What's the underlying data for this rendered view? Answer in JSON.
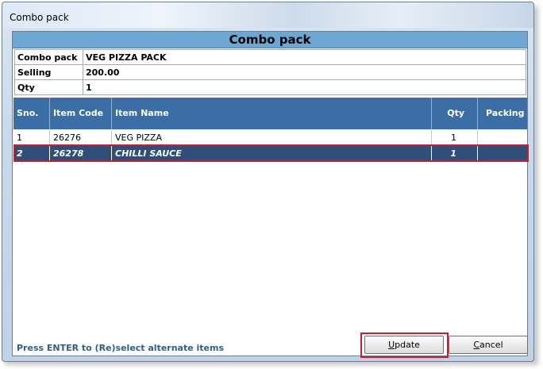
{
  "window": {
    "title": "Combo pack"
  },
  "header": {
    "title": "Combo pack"
  },
  "info": [
    {
      "label": "Combo pack",
      "value": "VEG PIZZA PACK"
    },
    {
      "label": "Selling",
      "value": "200.00"
    },
    {
      "label": "Qty",
      "value": "1"
    }
  ],
  "grid": {
    "columns": [
      "Sno.",
      "Item Code",
      "Item Name",
      "Qty",
      "Packing"
    ],
    "rows": [
      {
        "sno": "1",
        "code": "26276",
        "name": "VEG PIZZA",
        "qty": "1",
        "packing": ""
      },
      {
        "sno": "2",
        "code": "26278",
        "name": "CHILLI SAUCE",
        "qty": "1",
        "packing": "",
        "selected": true
      }
    ]
  },
  "status": {
    "text": "Press ENTER to (Re)select alternate items"
  },
  "buttons": {
    "update_accel": "U",
    "update_rest": "pdate",
    "cancel_accel": "C",
    "cancel_rest": "ancel"
  },
  "colors": {
    "header_bar": "#6fa7d3",
    "grid_header": "#3a6ea5",
    "selected_row": "#2f4f7a",
    "highlight_outline": "#c21f32",
    "status_text": "#2f5f86"
  }
}
